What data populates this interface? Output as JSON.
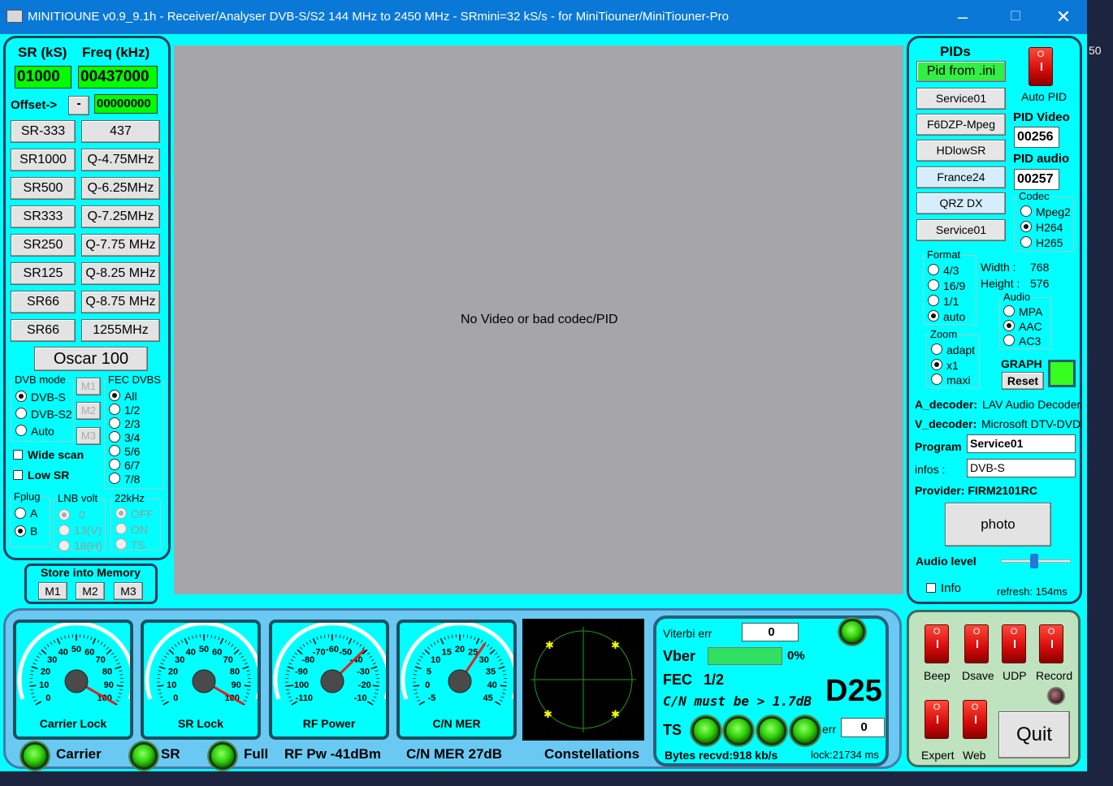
{
  "title": "MINITIOUNE v0.9_9.1h - Receiver/Analyser DVB-S/S2 144 MHz to 2450 MHz - SRmini=32 kS/s - for MiniTiouner/MiniTiouner-Pro",
  "left": {
    "sr_label": "SR (kS)",
    "freq_label": "Freq (kHz)",
    "sr_value": "01000",
    "freq_value": "00437000",
    "offset_label": "Offset->",
    "offset_sign": "-",
    "offset_value": "00000000",
    "sr_buttons": [
      "SR-333",
      "SR1000",
      "SR500",
      "SR333",
      "SR250",
      "SR125",
      "SR66",
      "SR66"
    ],
    "freq_buttons": [
      "437",
      "Q-4.75MHz",
      "Q-6.25MHz",
      "Q-7.25MHz",
      "Q-7.75 MHz",
      "Q-8.25 MHz",
      "Q-8.75 MHz",
      "1255MHz"
    ],
    "oscar": "Oscar 100",
    "dvb_mode_label": "DVB mode",
    "dvb_modes": [
      "DVB-S",
      "DVB-S2",
      "Auto"
    ],
    "mem_buttons": [
      "M1",
      "M2",
      "M3"
    ],
    "fec_label": "FEC DVBS",
    "fec": [
      "All",
      "1/2",
      "2/3",
      "3/4",
      "5/6",
      "6/7",
      "7/8"
    ],
    "wide_scan": "Wide scan",
    "low_sr": "Low SR",
    "fplug_label": "Fplug",
    "fplug": [
      "A",
      "B"
    ],
    "lnb_label": "LNB volt",
    "lnb": [
      "0",
      "13(V)",
      "18(H)"
    ],
    "khz_label": "22kHz",
    "khz": [
      "OFF",
      "ON",
      "TS"
    ],
    "store_label": "Store into Memory",
    "store_buttons": [
      "M1",
      "M2",
      "M3"
    ]
  },
  "video": {
    "message": "No Video or bad codec/PID"
  },
  "right": {
    "pids_label": "PIDs",
    "pid_ini": "Pid from .ini",
    "auto_pid": "Auto PID",
    "services": [
      "Service01",
      "F6DZP-Mpeg",
      "HDlowSR",
      "France24",
      "QRZ DX",
      "Service01"
    ],
    "pid_video_label": "PID Video",
    "pid_video": "00256",
    "pid_audio_label": "PID audio",
    "pid_audio": "00257",
    "codec_label": "Codec",
    "codecs": [
      "Mpeg2",
      "H264",
      "H265"
    ],
    "format_label": "Format",
    "formats": [
      "4/3",
      "16/9",
      "1/1",
      "auto"
    ],
    "width_label": "Width :",
    "width_val": "768",
    "height_label": "Height :",
    "height_val": "576",
    "audio_label": "Audio",
    "audios": [
      "MPA",
      "AAC",
      "AC3"
    ],
    "zoom_label": "Zoom",
    "zooms": [
      "adapt",
      "x1",
      "maxi"
    ],
    "graph_label": "GRAPH",
    "reset": "Reset",
    "a_decoder_label": "A_decoder:",
    "a_decoder": "LAV Audio Decoder",
    "v_decoder_label": "V_decoder:",
    "v_decoder": "Microsoft DTV-DVD",
    "program_label": "Program",
    "program": "Service01",
    "infos_label": "infos :",
    "infos": "DVB-S",
    "provider": "Provider: FIRM2101RC",
    "photo": "photo",
    "audio_level": "Audio level",
    "info": "Info",
    "refresh": "refresh: 154ms"
  },
  "gauges": [
    {
      "name": "Carrier Lock",
      "ticks": [
        "0",
        "10",
        "20",
        "30",
        "40",
        "50",
        "60",
        "70",
        "80",
        "90",
        "100"
      ],
      "value": 100
    },
    {
      "name": "SR Lock",
      "ticks": [
        "0",
        "10",
        "20",
        "30",
        "40",
        "50",
        "60",
        "70",
        "80",
        "90",
        "100"
      ],
      "value": 100
    },
    {
      "name": "RF Power",
      "ticks": [
        "-110",
        "-100",
        "-90",
        "-80",
        "-70",
        "-60",
        "-50",
        "-40",
        "-30",
        "-20",
        "-10"
      ],
      "value": -41
    },
    {
      "name": "C/N MER",
      "ticks": [
        "-5",
        "0",
        "5",
        "10",
        "15",
        "20",
        "25",
        "30",
        "35",
        "40",
        "45"
      ],
      "value": 27
    }
  ],
  "status": {
    "carrier": "Carrier",
    "sr": "SR",
    "full": "Full",
    "rf_pw": "RF Pw  -41dBm",
    "cn_mer": "C/N MER  27dB",
    "constellations": "Constellations"
  },
  "stats": {
    "viterbi_label": "Viterbi err",
    "viterbi": "0",
    "vber_label": "Vber",
    "vber": "0%",
    "vber_fill": 0.0,
    "fec_label": "FEC",
    "fec": "1/2",
    "cn_must": "C/N must be > 1.7dB",
    "mode": "D25",
    "ts_label": "TS",
    "err_label": "err",
    "err": "0",
    "bytes": "Bytes recvd:918 kb/s",
    "lock": "lock:21734 ms"
  },
  "controls": {
    "buttons": [
      "Beep",
      "Dsave",
      "UDP",
      "Record",
      "Expert",
      "Web"
    ],
    "quit": "Quit"
  },
  "colors": {
    "panel": "#00ffff",
    "title": "#0a78d7",
    "led": "#2fd10a",
    "field": "#00ff00"
  },
  "desktop_digit": "50"
}
